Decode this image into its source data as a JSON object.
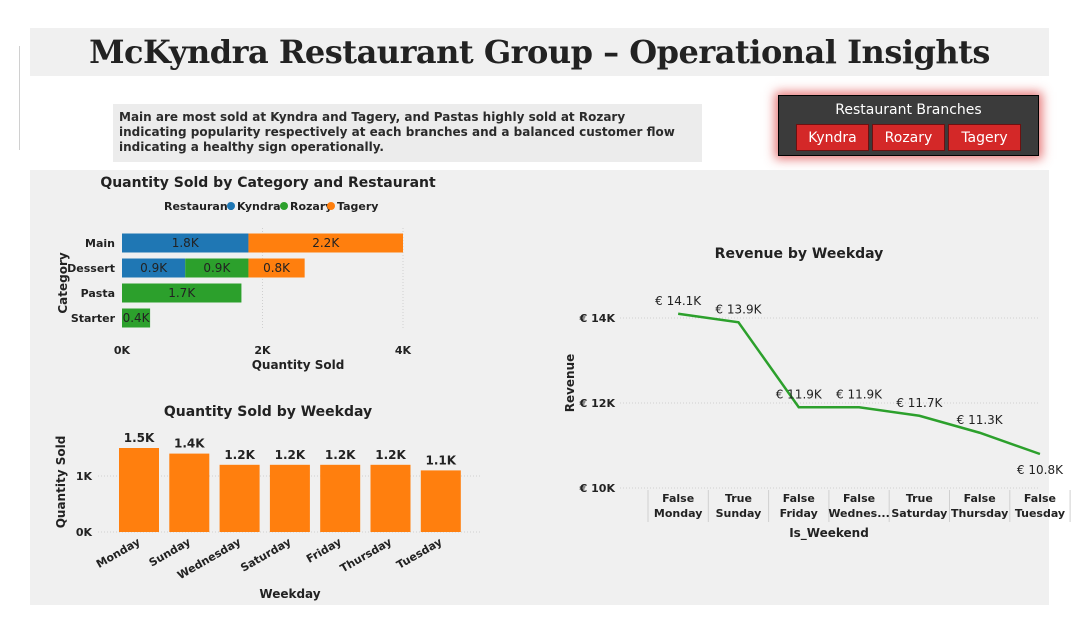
{
  "title": "McKyndra Restaurant Group – Operational Insights",
  "insight_text": "Main are most sold at Kyndra and Tagery, and Pastas highly sold at Rozary indicating popularity respectively at each branches and a balanced customer flow indicating a healthy sign operationally.",
  "slicer": {
    "title": "Restaurant Branches",
    "items": [
      "Kyndra",
      "Rozary",
      "Tagery"
    ]
  },
  "colors": {
    "kyndra": "#1f77b4",
    "rozary": "#2ca02c",
    "tagery": "#ff7f0e",
    "line": "#2ca02c",
    "slicer_button": "#d42828"
  },
  "chart_data": [
    {
      "type": "bar",
      "orientation": "horizontal",
      "stacked": true,
      "title": "Quantity Sold by Category and Restaurant",
      "legend_title": "Restaurant",
      "legend_position": "top",
      "xlabel": "Quantity Sold",
      "ylabel": "Category",
      "x_ticks": [
        "0K",
        "2K",
        "4K"
      ],
      "xlim": [
        0,
        4000
      ],
      "categories": [
        "Main",
        "Dessert",
        "Pasta",
        "Starter"
      ],
      "series": [
        {
          "name": "Kyndra",
          "values": [
            1800,
            900,
            0,
            0
          ],
          "labels": [
            "1.8K",
            "0.9K",
            "",
            ""
          ]
        },
        {
          "name": "Rozary",
          "values": [
            0,
            900,
            1700,
            400
          ],
          "labels": [
            "",
            "0.9K",
            "1.7K",
            "0.4K"
          ]
        },
        {
          "name": "Tagery",
          "values": [
            2200,
            800,
            0,
            0
          ],
          "labels": [
            "2.2K",
            "0.8K",
            "",
            ""
          ]
        }
      ]
    },
    {
      "type": "bar",
      "title": "Quantity Sold by Weekday",
      "xlabel": "Weekday",
      "ylabel": "Quantity Sold",
      "y_ticks": [
        "0K",
        "1K"
      ],
      "ylim": [
        0,
        1500
      ],
      "categories": [
        "Monday",
        "Sunday",
        "Wednesday",
        "Saturday",
        "Friday",
        "Thursday",
        "Tuesday"
      ],
      "values": [
        1500,
        1400,
        1200,
        1200,
        1200,
        1200,
        1100
      ],
      "labels": [
        "1.5K",
        "1.4K",
        "1.2K",
        "1.2K",
        "1.2K",
        "1.2K",
        "1.1K"
      ]
    },
    {
      "type": "line",
      "title": "Revenue by Weekday",
      "xlabel": "Is_Weekend",
      "ylabel": "Revenue",
      "y_ticks": [
        "€ 10K",
        "€ 12K",
        "€ 14K"
      ],
      "ylim": [
        10000,
        14000
      ],
      "categories": [
        [
          "False",
          "Monday"
        ],
        [
          "True",
          "Sunday"
        ],
        [
          "False",
          "Friday"
        ],
        [
          "False",
          "Wednes..."
        ],
        [
          "True",
          "Saturday"
        ],
        [
          "False",
          "Thursday"
        ],
        [
          "False",
          "Tuesday"
        ]
      ],
      "values": [
        14100,
        13900,
        11900,
        11900,
        11700,
        11300,
        10800
      ],
      "labels": [
        "€ 14.1K",
        "€ 13.9K",
        "€ 11.9K",
        "€ 11.9K",
        "€ 11.7K",
        "€ 11.3K",
        "€ 10.8K"
      ]
    }
  ]
}
